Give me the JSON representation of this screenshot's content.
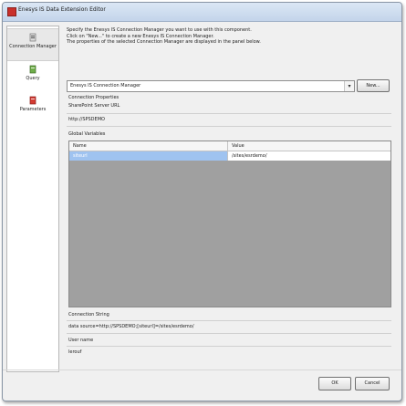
{
  "window": {
    "title": "Enesys IS Data Extension Editor"
  },
  "sidebar": {
    "items": [
      {
        "label": "Connection Manager",
        "icon": "connection-icon",
        "selected": true
      },
      {
        "label": "Query",
        "icon": "query-icon",
        "selected": false
      },
      {
        "label": "Parameters",
        "icon": "parameters-icon",
        "selected": false
      }
    ]
  },
  "intro": {
    "line1": "Specify the Enesys IS Connection Manager you want to use with this component.",
    "line2": "Click on \"New...\" to create a new Enesys IS Connection Manager.",
    "line3": "The properties of the selected Connection Manager are displayed in the panel below."
  },
  "connection_select": {
    "value": "Enesys IS Connection Manager"
  },
  "buttons": {
    "new": "New...",
    "ok": "OK",
    "cancel": "Cancel"
  },
  "properties": {
    "heading": "Connection Properties",
    "server_url_label": "SharePoint Server URL",
    "server_url_value": "http://SPSDEMO"
  },
  "global_variables": {
    "label": "Global Variables",
    "columns": [
      "Name",
      "Value"
    ],
    "rows": [
      {
        "name": "siteurl",
        "value": "/sites/esrdemo/"
      }
    ]
  },
  "connection_string": {
    "label": "Connection String",
    "value": "data source=http://SPSDEMO;[siteurl]=/sites/esrdemo/"
  },
  "user_name": {
    "label": "User name",
    "value": "lerouf"
  },
  "colors": {
    "selection": "#9fc3f0",
    "grid_background": "#a0a0a0",
    "dialog_background": "#f0f0f0"
  }
}
